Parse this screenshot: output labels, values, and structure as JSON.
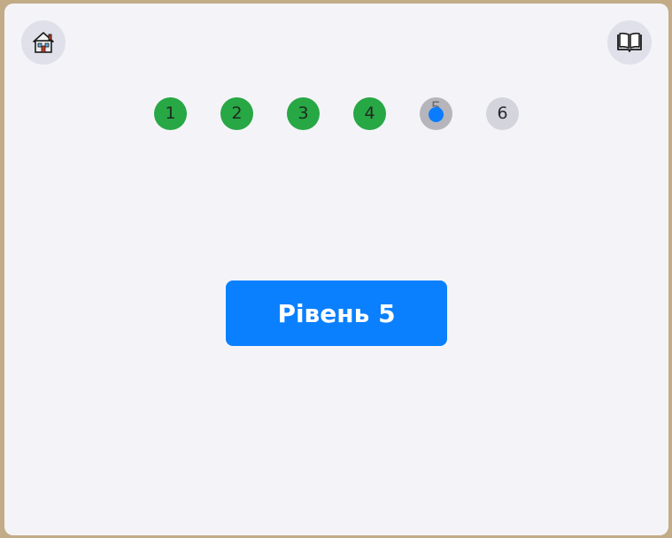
{
  "toolbar": {
    "home_icon": "house-icon",
    "book_icon": "open-book-icon"
  },
  "levels": [
    {
      "label": "1",
      "state": "completed"
    },
    {
      "label": "2",
      "state": "completed"
    },
    {
      "label": "3",
      "state": "completed"
    },
    {
      "label": "4",
      "state": "completed"
    },
    {
      "label": "5",
      "state": "current"
    },
    {
      "label": "6",
      "state": "locked"
    }
  ],
  "main": {
    "play_label": "Рівень 5"
  },
  "colors": {
    "completed": "#28a745",
    "current_marker": "#0a7cff",
    "button": "#0a80ff",
    "background": "#f4f4f8",
    "border": "#c2ab87"
  }
}
